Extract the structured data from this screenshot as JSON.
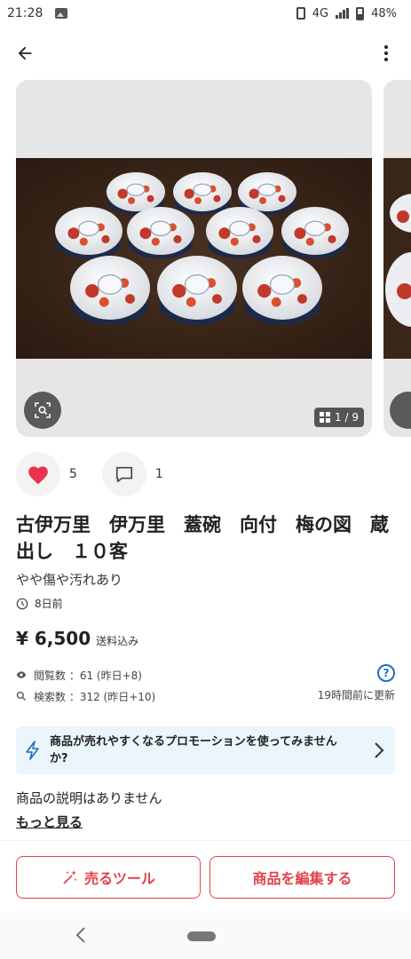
{
  "status_bar": {
    "time": "21:28",
    "network": "4G",
    "battery": "48%"
  },
  "photo": {
    "page_indicator": "1 / 9"
  },
  "engagement": {
    "likes": "5",
    "comments": "1"
  },
  "item": {
    "title": "古伊万里　伊万里　蓋碗　向付　梅の図　蔵出し　１０客",
    "condition": "やや傷や汚れあり",
    "posted": "8日前",
    "price": "¥ 6,500",
    "shipping": "送料込み"
  },
  "stats": {
    "views": "閲覧数 ：61 (昨日+8)",
    "searches": "検索数 ：312 (昨日+10)",
    "updated": "19時間前に更新",
    "help": "?"
  },
  "promo": {
    "text": "商品が売れやすくなるプロモーションを使ってみませんか?"
  },
  "description": {
    "text": "商品の説明はありません",
    "more": "もっと見る"
  },
  "buttons": {
    "sell_tools": "売るツール",
    "edit_item": "商品を編集する"
  },
  "colors": {
    "accent": "#e0434b",
    "heart": "#e8334a",
    "link_blue": "#1b6ec2",
    "promo_bg": "#eaf5fc"
  }
}
